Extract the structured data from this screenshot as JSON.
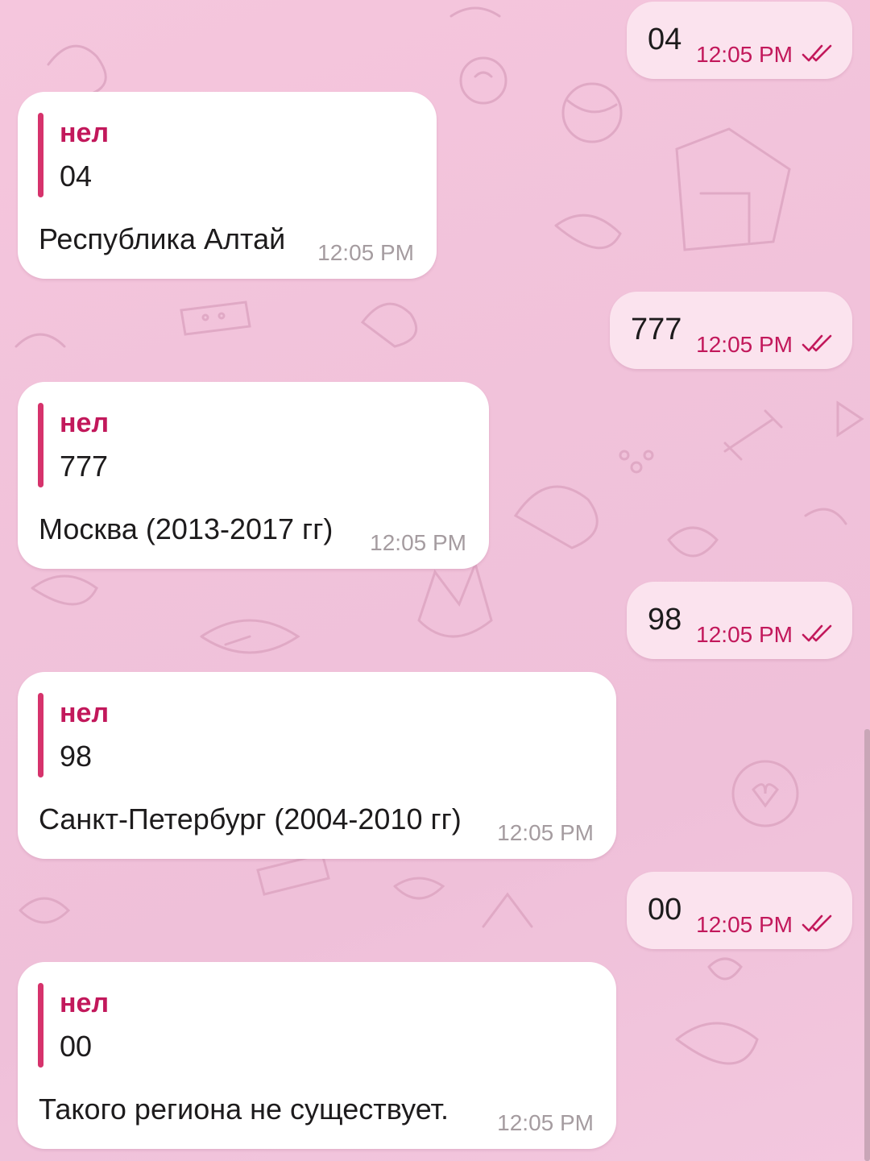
{
  "chat": {
    "colors": {
      "background": "#f3c6dd",
      "outgoing_bubble": "#fbe3ee",
      "incoming_bubble": "#ffffff",
      "accent": "#c2185b",
      "quote_bar": "#d6336c",
      "incoming_time": "#a59ca0"
    },
    "messages": [
      {
        "direction": "outgoing",
        "text": "04",
        "time": "12:05 PM",
        "status_icon": "double-check-icon"
      },
      {
        "direction": "incoming",
        "quote_name": "нел",
        "quote_text": "04",
        "text": "Республика Алтай",
        "time": "12:05 PM"
      },
      {
        "direction": "outgoing",
        "text": "777",
        "time": "12:05 PM",
        "status_icon": "double-check-icon"
      },
      {
        "direction": "incoming",
        "quote_name": "нел",
        "quote_text": "777",
        "text": "Москва (2013-2017 гг)",
        "time": "12:05 PM"
      },
      {
        "direction": "outgoing",
        "text": "98",
        "time": "12:05 PM",
        "status_icon": "double-check-icon"
      },
      {
        "direction": "incoming",
        "quote_name": "нел",
        "quote_text": "98",
        "text": "Санкт-Петербург (2004-2010 гг)",
        "time": "12:05 PM"
      },
      {
        "direction": "outgoing",
        "text": "00",
        "time": "12:05 PM",
        "status_icon": "double-check-icon"
      },
      {
        "direction": "incoming",
        "quote_name": "нел",
        "quote_text": "00",
        "text": "Такого региона не существует.",
        "time": "12:05 PM"
      }
    ]
  }
}
